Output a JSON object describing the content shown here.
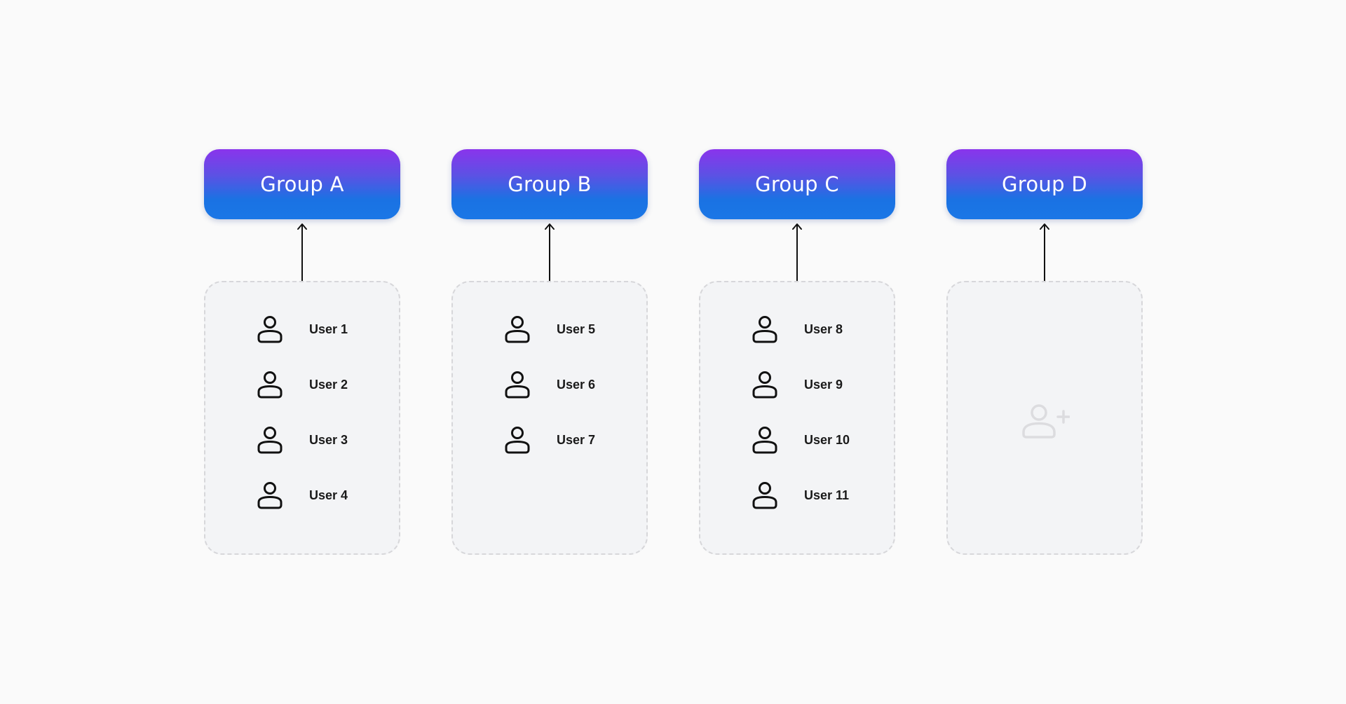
{
  "groups": [
    {
      "title": "Group A",
      "users": [
        "User 1",
        "User 2",
        "User 3",
        "User 4"
      ]
    },
    {
      "title": "Group B",
      "users": [
        "User 5",
        "User 6",
        "User 7"
      ]
    },
    {
      "title": "Group C",
      "users": [
        "User 8",
        "User 9",
        "User 10",
        "User 11"
      ]
    },
    {
      "title": "Group D",
      "users": []
    }
  ],
  "colors": {
    "header_gradient_top": "#8a34ec",
    "header_gradient_bottom": "#1b77e6",
    "connector": "#111111",
    "box_border": "#d7d7da",
    "box_fill": "#f3f4f6",
    "add_user_icon": "#dcdcdf"
  },
  "icons": {
    "user": "user-icon",
    "add_user": "add-user-icon",
    "connector_arrow": "arrow-up-icon"
  }
}
